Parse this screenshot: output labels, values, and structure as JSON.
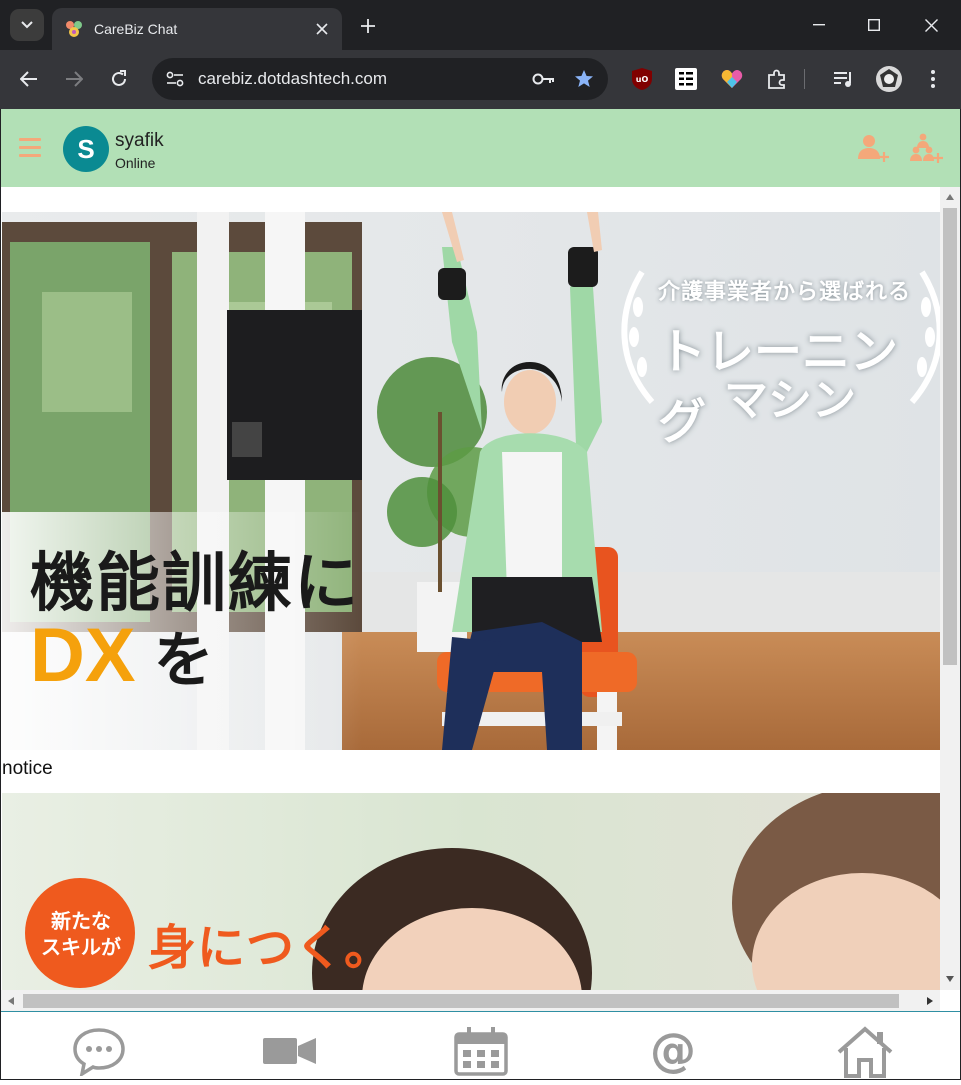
{
  "browser": {
    "tab_title": "CareBiz Chat",
    "url": "carebiz.dotdashtech.com",
    "accent": "#8ab4f8"
  },
  "header": {
    "background": "#b2e0b6",
    "avatar_initial": "S",
    "avatar_color": "#0a8a92",
    "username": "syafik",
    "status": "Online",
    "icons": [
      "menu-icon",
      "add-user-icon",
      "add-group-icon"
    ]
  },
  "content": {
    "banner1": {
      "tagline": "介護事業者から選ばれる",
      "title_line1": "トレーニング",
      "title_line2": "マシン",
      "headline": "機能訓練に",
      "dx": "DX",
      "wo": "を"
    },
    "notice_label": "notice",
    "banner2": {
      "badge_line1": "新たな",
      "badge_line2": "スキルが",
      "headline": "身につく。"
    }
  },
  "bottom_nav": {
    "items": [
      "chat-icon",
      "video-icon",
      "calendar-icon",
      "mention-icon",
      "home-icon"
    ]
  }
}
